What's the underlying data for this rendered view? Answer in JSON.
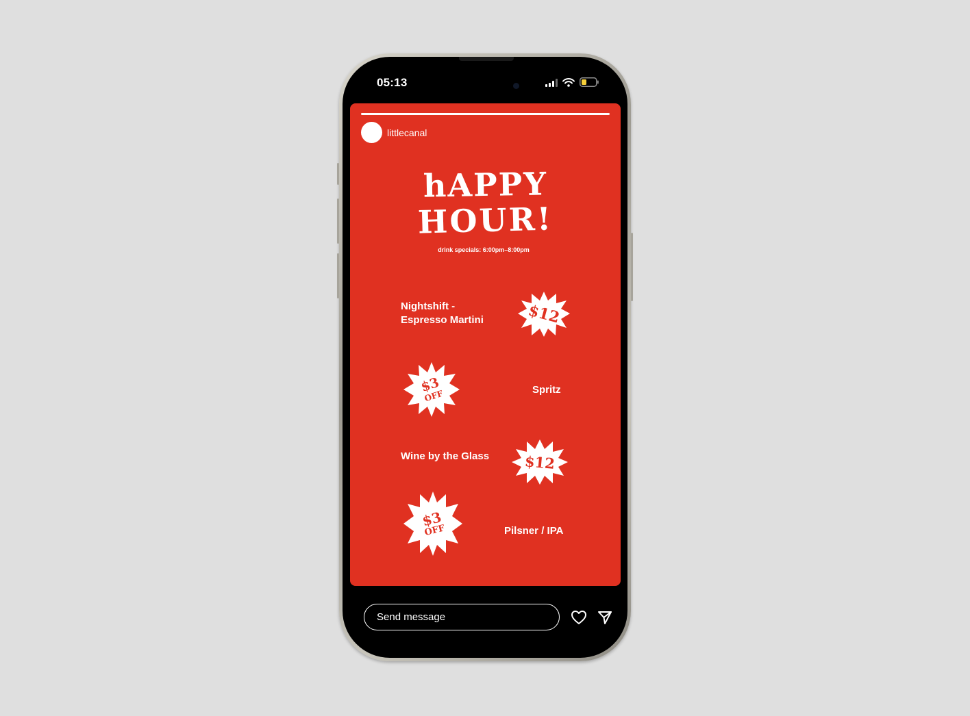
{
  "status_bar": {
    "time": "05:13"
  },
  "story": {
    "username": "littlecanal",
    "title_line1": "hAPPY",
    "title_line2": "HOUR!",
    "subtitle": "drink specials: 6:00pm–8:00pm",
    "accent_color": "#e03121",
    "items": [
      {
        "name_line1": "Nightshift -",
        "name_line2": "Espresso Martini",
        "price_line1": "$12",
        "price_line2": ""
      },
      {
        "name_line1": "Spritz",
        "name_line2": "",
        "price_line1": "$3",
        "price_line2": "OFF"
      },
      {
        "name_line1": "Wine by the Glass",
        "name_line2": "",
        "price_line1": "$12",
        "price_line2": ""
      },
      {
        "name_line1": "Pilsner / IPA",
        "name_line2": "",
        "price_line1": "$3",
        "price_line2": "OFF"
      }
    ]
  },
  "footer": {
    "message_placeholder": "Send message",
    "like_icon": "heart-icon",
    "share_icon": "send-icon"
  }
}
